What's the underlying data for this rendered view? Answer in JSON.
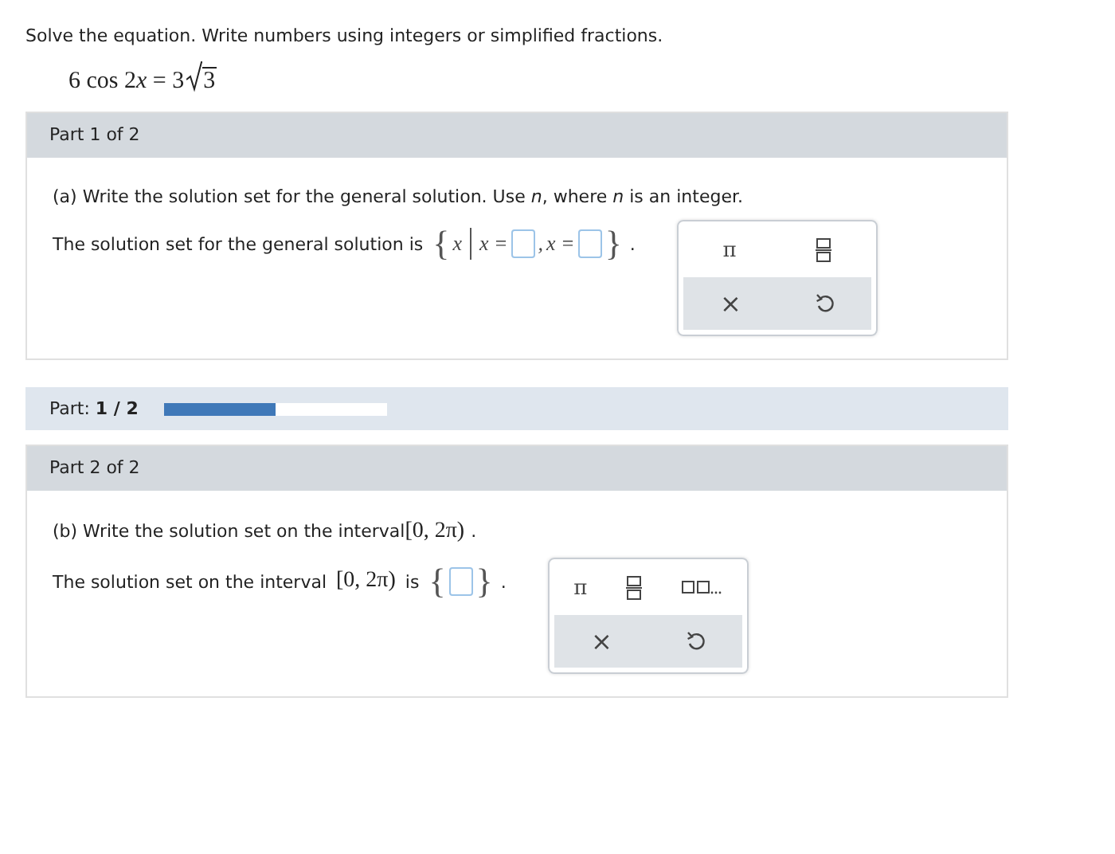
{
  "instruction": "Solve the equation. Write numbers using integers or simplified fractions.",
  "equation": {
    "left": "6 cos 2",
    "variable": "x",
    "right": "= 3",
    "radicand": "3"
  },
  "parts": [
    {
      "header": "Part 1 of 2",
      "prompt": "(a) Write the solution set for the general solution. Use *n*, where *n* is an integer.",
      "lead": "The solution set for the general solution is",
      "tokens": [
        {
          "kind": "brace",
          "text": "{"
        },
        {
          "kind": "math",
          "text": "x"
        },
        {
          "kind": "bar"
        },
        {
          "kind": "math",
          "text": "x ="
        },
        {
          "kind": "box"
        },
        {
          "kind": "math",
          "text": ","
        },
        {
          "kind": "math",
          "text": "x ="
        },
        {
          "kind": "box"
        },
        {
          "kind": "brace",
          "text": "}"
        },
        {
          "kind": "plain",
          "text": "."
        }
      ],
      "keys": [
        {
          "kind": "pi",
          "text": "π"
        },
        {
          "kind": "fraction"
        }
      ],
      "actions": [
        {
          "kind": "clear",
          "text": "×"
        },
        {
          "kind": "undo"
        }
      ]
    },
    {
      "header": "Part 2 of 2",
      "prompt": "(b) Write the solution set on the interval",
      "prompt_interval": "[0, 2π)",
      "prompt_end": ".",
      "lead": "The solution set on the interval",
      "lead_interval": "[0, 2π)",
      "lead_end": "is",
      "tokens": [
        {
          "kind": "brace",
          "text": "{"
        },
        {
          "kind": "box"
        },
        {
          "kind": "brace",
          "text": "}"
        },
        {
          "kind": "plain",
          "text": "."
        }
      ],
      "keys": [
        {
          "kind": "pi",
          "text": "π"
        },
        {
          "kind": "fraction"
        },
        {
          "kind": "list"
        }
      ],
      "actions": [
        {
          "kind": "clear",
          "text": "×"
        },
        {
          "kind": "undo"
        }
      ]
    }
  ],
  "progress": {
    "label": "Part: **1 / 2**",
    "level": 0.5
  }
}
